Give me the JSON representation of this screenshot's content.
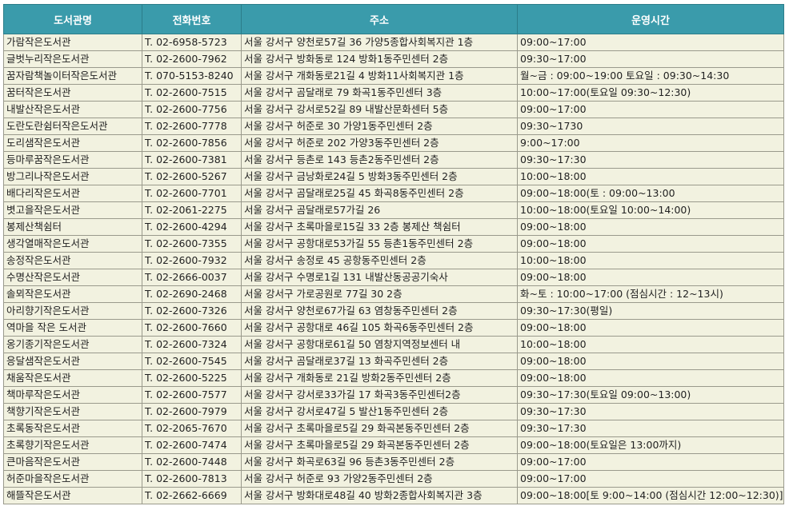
{
  "headers": [
    "도서관명",
    "전화번호",
    "주소",
    "운영시간"
  ],
  "rows": [
    [
      "가람작은도서관",
      "T. 02-6958-5723",
      "서울 강서구 양천로57길 36 가양5종합사회복지관 1층",
      "09:00~17:00"
    ],
    [
      "글벗누리작은도서관",
      " T. 02-2600-7962",
      "서울 강서구 방화동로 124 방화1동주민센터 2층",
      "09:30~17:00"
    ],
    [
      "꿈자람책놀이터작은도서관",
      "T. 070-5153-8240",
      "서울 강서구 개화동로21길 4 방화11사회복지관 1층",
      "월~금 : 09:00~19:00 토요일 : 09:30~14:30"
    ],
    [
      "꿈터작은도서관",
      "T. 02-2600-7515",
      "서울 강서구 곰달래로 79 화곡1동주민센터 3층",
      "10:00~17:00(토요일 09:30~12:30)"
    ],
    [
      "내발산작은도서관",
      "T. 02-2600-7756",
      "서울 강서구 강서로52길 89 내발산문화센터 5층",
      "09:00~17:00"
    ],
    [
      "도란도란쉼터작은도서관",
      "T. 02-2600-7778",
      "서울 강서구 허준로 30 가양1동주민센터 2층",
      "09:30~1730"
    ],
    [
      "도리샘작은도서관",
      "T. 02-2600-7856",
      "서울 강서구 허준로 202 가양3동주민센터 2층",
      "9:00~17:00"
    ],
    [
      "등마루꿈작은도서관",
      "T. 02-2600-7381",
      "서울 강서구 등촌로 143 등촌2동주민센터 2층",
      "09:30~17:30"
    ],
    [
      "방그리나작은도서관",
      "T. 02-2600-5267",
      "서울 강서구 금낭화로24길 5 방화3동주민센터 2층",
      "10:00~18:00"
    ],
    [
      "배다리작은도서관",
      "T. 02-2600-7701",
      "서울 강서구 곰달래로25길 45 화곡8동주민센터 2층",
      "09:00~18:00(토 : 09:00~13:00"
    ],
    [
      "볏고을작은도서관",
      "T. 02-2061-2275",
      "서울 강서구 곰달래로57가길 26",
      "10:00~18:00(토요일 10:00~14:00)"
    ],
    [
      "봉제산책쉼터",
      "T. 02-2600-4294",
      "서울 강서구 초록마을로15길 33 2층 봉제산 책쉼터",
      "09:00~18:00"
    ],
    [
      "생각열매작은도서관",
      "T. 02-2600-7355",
      "서울 강서구 공항대로53가길 55 등촌1동주민센터 2층",
      "09:00~18:00"
    ],
    [
      "송정작은도서관",
      "T. 02-2600-7932",
      "서울 강서구 송정로 45 공항동주민센터 2층",
      "10:00~18:00"
    ],
    [
      "수명산작은도서관",
      "T. 02-2666-0037",
      "서울 강서구 수명로1길 131 내발산동공공기숙사",
      "09:00~18:00"
    ],
    [
      "솔뫼작은도서관",
      "T. 02-2690-2468",
      "서울 강서구 가로공원로 77길 30 2층",
      "화~토 : 10:00~17:00 (점심시간 : 12~13시)"
    ],
    [
      "아리향기작은도서관",
      "T. 02-2600-7326",
      "서울 강서구 양천로67가길 63 염창동주민센터 2층",
      "09:30~17:30(평일)"
    ],
    [
      "역마을 작은 도서관",
      "T. 02-2600-7660",
      "서울 강서구 공항대로 46길 105 화곡6동주민센터 2층",
      "09:00~18:00"
    ],
    [
      "옹기종기작은도서관",
      "T. 02-2600-7324",
      "서울 강서구 공항대로61길 50 염창지역정보센터 내",
      "10:00~18:00"
    ],
    [
      "응달샘작은도서관",
      "T. 02-2600-7545",
      "서울 강서구 곰달래로37길 13 화곡주민센터 2층",
      "09:00~18:00"
    ],
    [
      "채움작은도서관",
      "T. 02-2600-5225",
      "서울 강서구 개화동로 21길 방화2동주민센터 2층",
      "09:00~18:00"
    ],
    [
      "책마루작은도서관",
      "T. 02-2600-7577",
      "서울 강서구 강서로33가길 17 화곡3동주민센터2층",
      "09:30~17:30(토요일 09:00~13:00)"
    ],
    [
      "책향기작은도서관",
      "T. 02-2600-7979",
      "서울 강서구 강서로47길 5 발산1동주민센터 2층",
      "09:30~17:30"
    ],
    [
      "초록동작은도서관",
      "T. 02-2065-7670",
      "서울 강서구 초록마을로5길 29 화곡본동주민센터 2층",
      "09:30~17:30"
    ],
    [
      "초록향기작은도서관",
      "T. 02-2600-7474",
      "서울 강서구 초록마을로5길 29 화곡본동주민센터 2층",
      "09:00~18:00(토요일은 13:00까지)"
    ],
    [
      "큰마음작은도서관",
      "T. 02-2600-7448",
      "서울 강서구 화곡로63길 96 등촌3동주민센터 2층",
      "09:00~17:00"
    ],
    [
      "허준마을작은도서관",
      "T. 02-2600-7813",
      "서울 강서구 허준로 93 가양2동주민센터 2층",
      "09:00~17:00"
    ],
    [
      "해뜰작은도서관",
      "T. 02-2662-6669",
      "서울 강서구 방화대로48길 40 방화2종합사회복지관 3층",
      "09:00~18:00[토 9:00~14:00 (점심시간 12:00~12:30)]"
    ]
  ]
}
